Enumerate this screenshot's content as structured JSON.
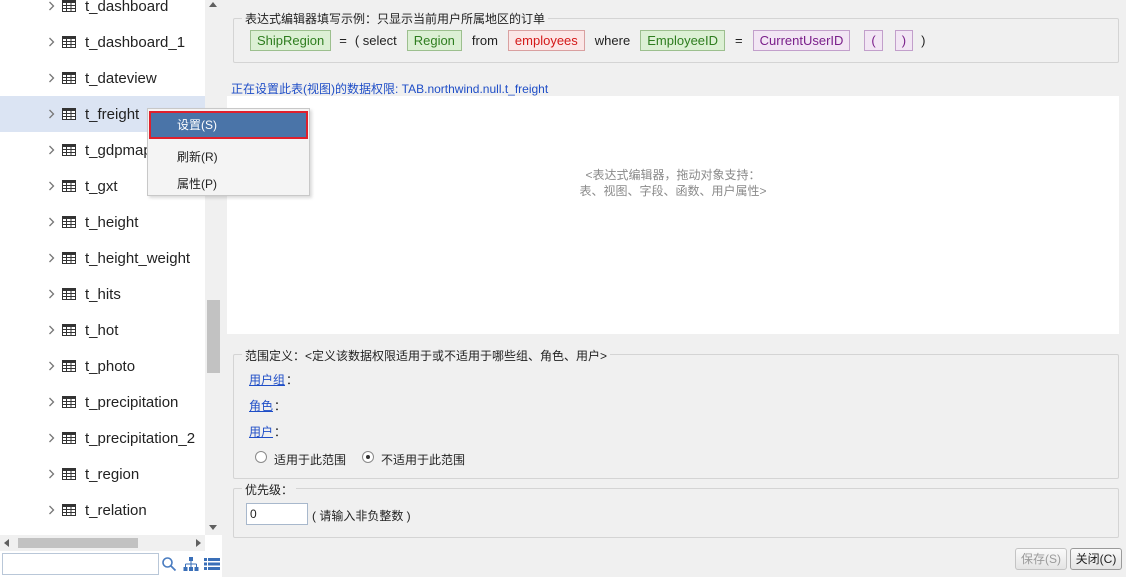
{
  "tree": {
    "items": [
      {
        "label": "t_dashboard"
      },
      {
        "label": "t_dashboard_1"
      },
      {
        "label": "t_dateview"
      },
      {
        "label": "t_freight"
      },
      {
        "label": "t_gdpmap"
      },
      {
        "label": "t_gxt"
      },
      {
        "label": "t_height"
      },
      {
        "label": "t_height_weight"
      },
      {
        "label": "t_hits"
      },
      {
        "label": "t_hot"
      },
      {
        "label": "t_photo"
      },
      {
        "label": "t_precipitation"
      },
      {
        "label": "t_precipitation_2"
      },
      {
        "label": "t_region"
      },
      {
        "label": "t_relation"
      }
    ],
    "selected_index": 3,
    "search": {
      "value": ""
    }
  },
  "context_menu": {
    "items": [
      {
        "label": "设置(S)"
      },
      {
        "label": "刷新(R)"
      },
      {
        "label": "属性(P)"
      }
    ]
  },
  "example": {
    "legend": "表达式编辑器填写示例：只显示当前用户所属地区的订单",
    "tokens": [
      {
        "text": "ShipRegion",
        "style": "green"
      },
      {
        "text": "=",
        "style": "plain"
      },
      {
        "text": "( select",
        "style": "plain"
      },
      {
        "text": "Region",
        "style": "green"
      },
      {
        "text": "from",
        "style": "plain"
      },
      {
        "text": "employees",
        "style": "red"
      },
      {
        "text": "where",
        "style": "plain"
      },
      {
        "text": "EmployeeID",
        "style": "green"
      },
      {
        "text": "=",
        "style": "plain"
      },
      {
        "text": "CurrentUserID",
        "style": "purple"
      },
      {
        "text": "(",
        "style": "purple"
      },
      {
        "text": ")",
        "style": "purple"
      },
      {
        "text": ")",
        "style": "plain"
      }
    ]
  },
  "editor": {
    "permission_label": "正在设置此表(视图)的数据权限: TAB.northwind.null.t_freight",
    "hint_line1": "<表达式编辑器，拖动对象支持：",
    "hint_line2": "表、视图、字段、函数、用户属性>"
  },
  "scope": {
    "legend": "范围定义：<定义该数据权限适用于或不适用于哪些组、角色、用户>",
    "user_group_link": "用户组",
    "role_link": "角色",
    "user_link": "用户",
    "colon": "：",
    "apply_label": "适用于此范围",
    "not_apply_label": "不适用于此范围",
    "selected": "not_apply"
  },
  "priority": {
    "legend": "优先级：",
    "value": "0",
    "hint": "( 请输入非负整数 )"
  },
  "buttons": {
    "save_label": "保存(S)",
    "close_label": "关闭(C)"
  },
  "colors": {
    "accent": "#4a74a8",
    "link": "#1f4ec7",
    "selection": "#dbe4f3",
    "highlight_border": "#e0202c"
  }
}
